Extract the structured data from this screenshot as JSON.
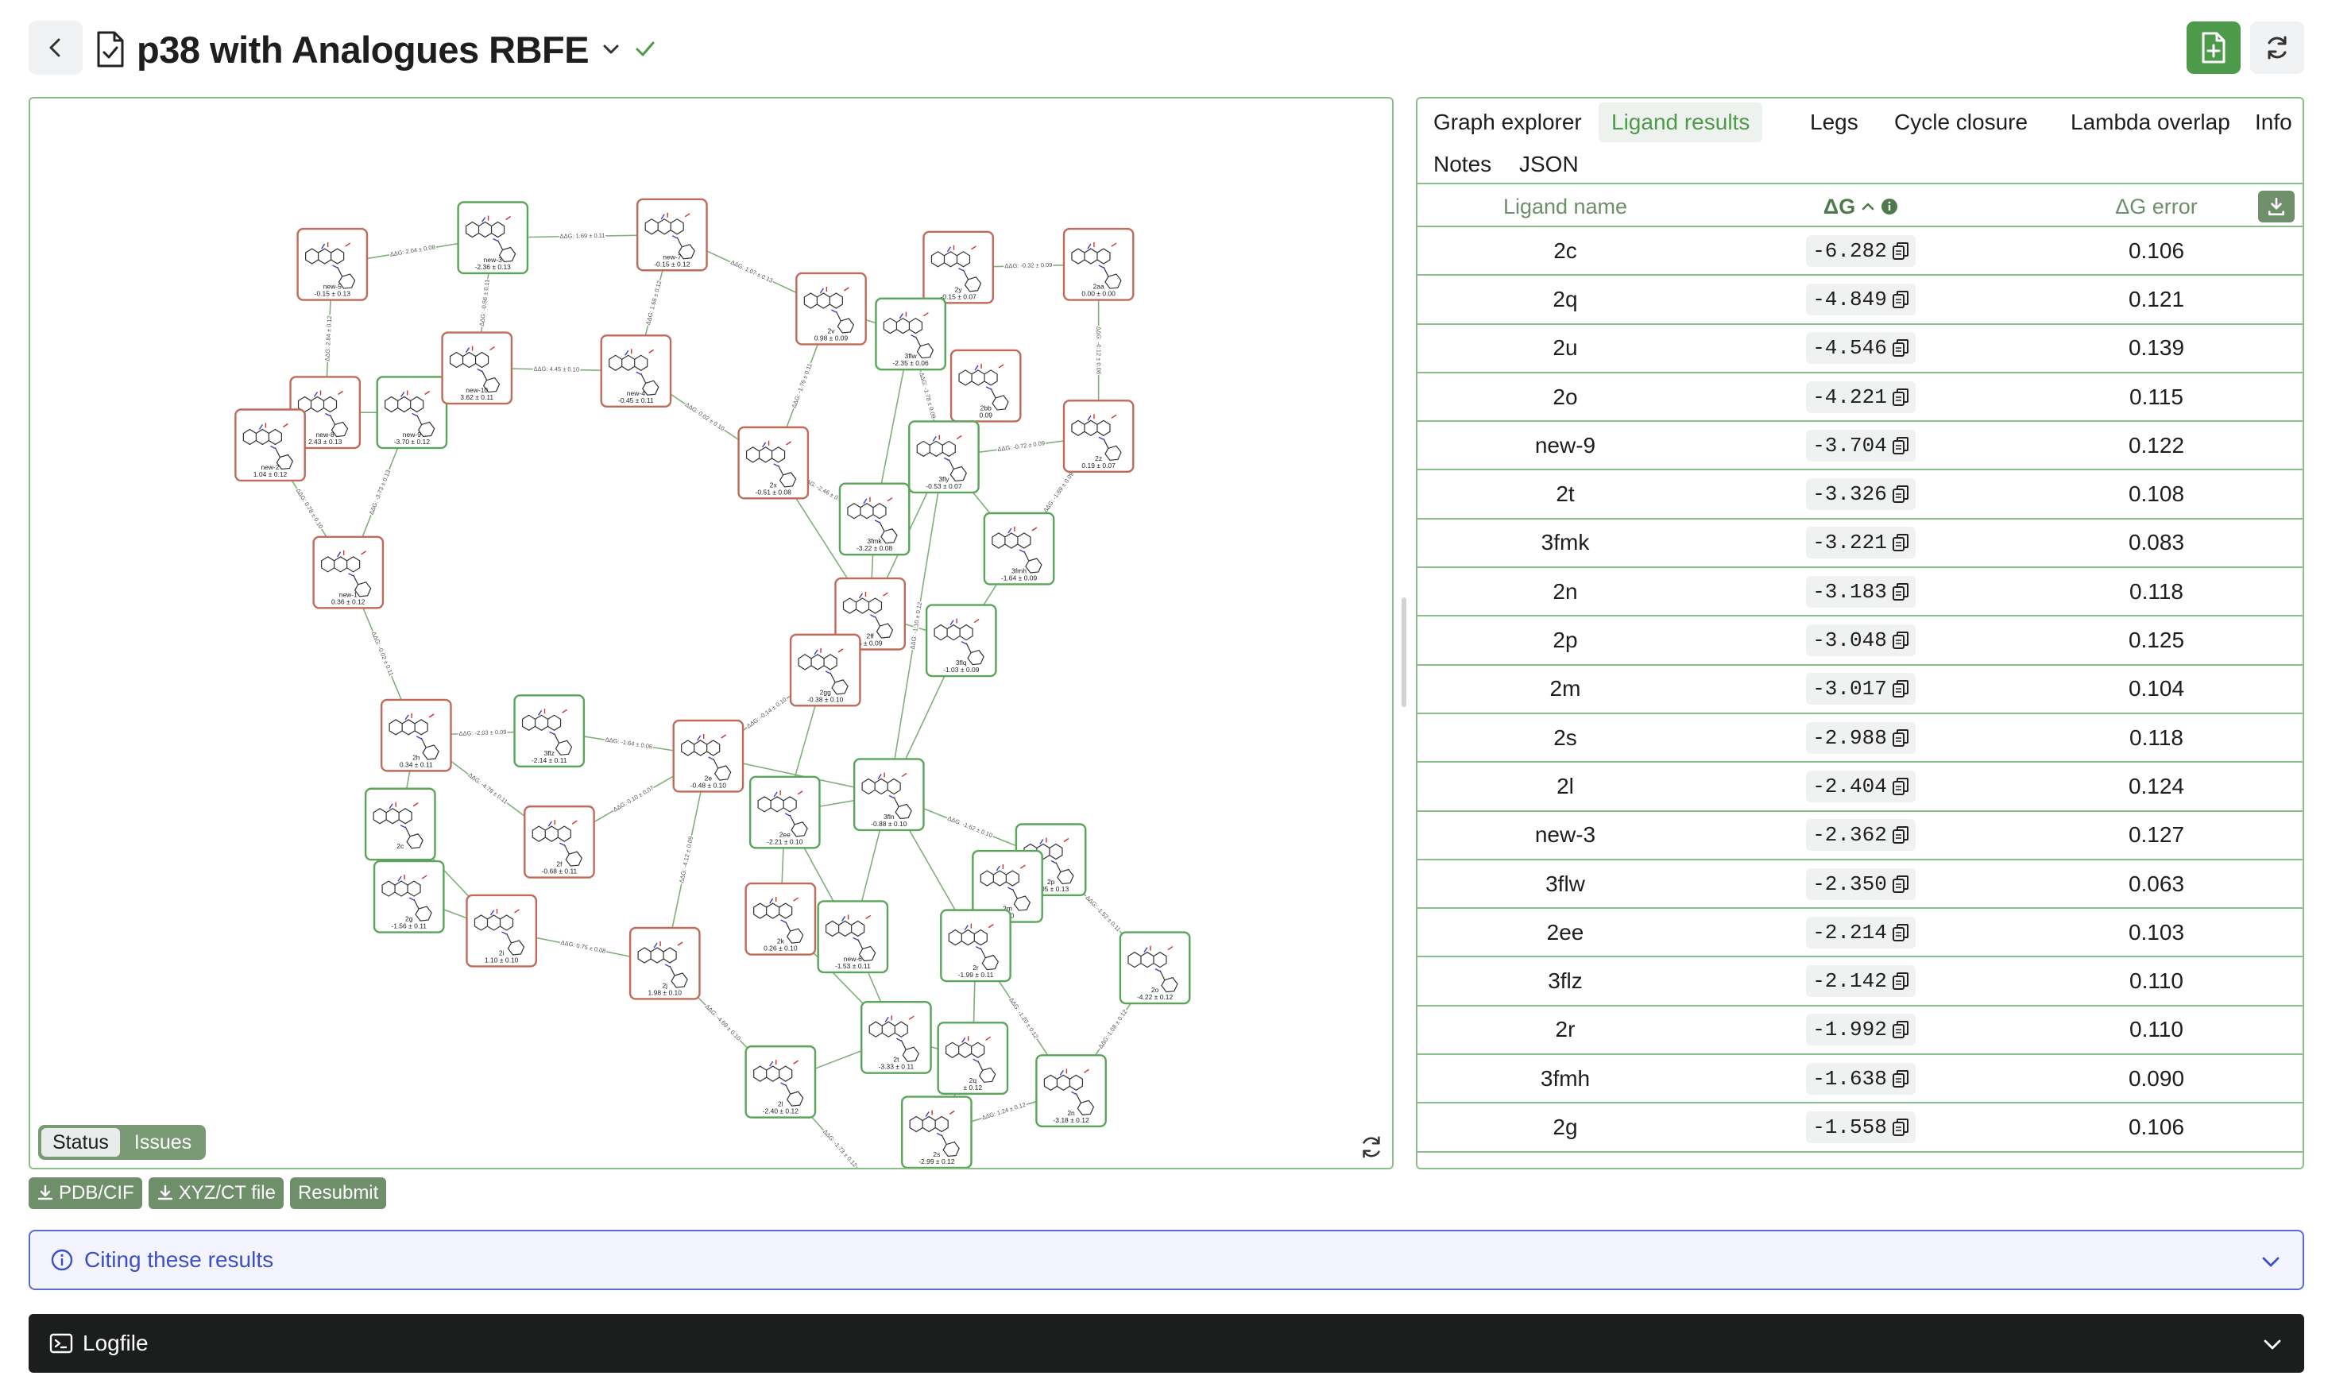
{
  "header": {
    "title": "p38 with Analogues RBFE",
    "status": "complete"
  },
  "graph": {
    "status_toggle": {
      "status_label": "Status",
      "issues_label": "Issues",
      "selected": "Status"
    },
    "colors": {
      "good": "#5aa55a",
      "bad": "#c06a5a",
      "edge": "#7fb07a",
      "node_bg": "#ffffff"
    },
    "nodes": [
      {
        "id": "new-5",
        "name": "new-5",
        "dg": "-0.15 ± 0.13",
        "status": "bad"
      },
      {
        "id": "new-3",
        "name": "new-3",
        "dg": "-2.36 ± 0.13",
        "status": "good"
      },
      {
        "id": "new-7",
        "name": "new-7",
        "dg": "-0.15 ± 0.12",
        "status": "bad"
      },
      {
        "id": "2v",
        "name": "2v",
        "dg": "0.98 ± 0.09",
        "status": "bad"
      },
      {
        "id": "2y",
        "name": "2y",
        "dg": "-0.15 ± 0.07",
        "status": "bad"
      },
      {
        "id": "3flw",
        "name": "3flw",
        "dg": "-2.35 ± 0.06",
        "status": "good"
      },
      {
        "id": "2aa",
        "name": "2aa",
        "dg": "0.00 ± 0.00",
        "status": "bad"
      },
      {
        "id": "2bb",
        "name": "2bb",
        "dg": "0.09",
        "status": "bad"
      },
      {
        "id": "new-8",
        "name": "new-8",
        "dg": "2.43 ± 0.13",
        "status": "bad"
      },
      {
        "id": "new-2",
        "name": "new-2",
        "dg": "1.04 ± 0.12",
        "status": "bad"
      },
      {
        "id": "new-9",
        "name": "new-9",
        "dg": "-3.70 ± 0.12",
        "status": "good"
      },
      {
        "id": "new-10",
        "name": "new-10",
        "dg": "3.62 ± 0.11",
        "status": "bad"
      },
      {
        "id": "new-4",
        "name": "new-4",
        "dg": "-0.45 ± 0.11",
        "status": "bad"
      },
      {
        "id": "2x",
        "name": "2x",
        "dg": "-0.51 ± 0.08",
        "status": "bad"
      },
      {
        "id": "3fly",
        "name": "3fly",
        "dg": "-0.53 ± 0.07",
        "status": "good"
      },
      {
        "id": "2z",
        "name": "2z",
        "dg": "0.19 ± 0.07",
        "status": "bad"
      },
      {
        "id": "3fmk",
        "name": "3fmk",
        "dg": "-3.22 ± 0.08",
        "status": "good"
      },
      {
        "id": "3fmh",
        "name": "3fmh",
        "dg": "-1.64 ± 0.09",
        "status": "good"
      },
      {
        "id": "new-1",
        "name": "new-1",
        "dg": "0.36 ± 0.12",
        "status": "bad"
      },
      {
        "id": "2ff",
        "name": "2ff",
        "dg": "5 ± 0.09",
        "status": "bad"
      },
      {
        "id": "3fln",
        "name": "3flq",
        "dg": "-1.03 ± 0.09",
        "status": "good"
      },
      {
        "id": "2gg",
        "name": "2gg",
        "dg": "-0.38 ± 0.10",
        "status": "bad"
      },
      {
        "id": "2h",
        "name": "2h",
        "dg": "0.34 ± 0.11",
        "status": "bad"
      },
      {
        "id": "3flz",
        "name": "3flz",
        "dg": "-2.14 ± 0.11",
        "status": "good"
      },
      {
        "id": "2e",
        "name": "2e",
        "dg": "-0.48 ± 0.10",
        "status": "bad"
      },
      {
        "id": "2ee",
        "name": "2ee",
        "dg": "-2.21 ± 0.10",
        "status": "good"
      },
      {
        "id": "3fln2",
        "name": "3fln",
        "dg": "-0.88 ± 0.10",
        "status": "good"
      },
      {
        "id": "2c-a",
        "name": "2c",
        "dg": "",
        "status": "good"
      },
      {
        "id": "2f",
        "name": "2f",
        "dg": "-0.68 ± 0.11",
        "status": "bad"
      },
      {
        "id": "2p",
        "name": "2p",
        "dg": "-3.05 ± 0.13",
        "status": "good"
      },
      {
        "id": "2m",
        "name": "2m",
        "dg": "0.10",
        "status": "good"
      },
      {
        "id": "2g",
        "name": "2g",
        "dg": "-1.56 ± 0.11",
        "status": "good"
      },
      {
        "id": "2i",
        "name": "2i",
        "dg": "1.10 ± 0.10",
        "status": "bad"
      },
      {
        "id": "2j",
        "name": "2j",
        "dg": "1.98 ± 0.10",
        "status": "bad"
      },
      {
        "id": "2k",
        "name": "2k",
        "dg": "0.26 ± 0.10",
        "status": "bad"
      },
      {
        "id": "new-6",
        "name": "new-6",
        "dg": "-1.53 ± 0.11",
        "status": "good"
      },
      {
        "id": "2r",
        "name": "2r",
        "dg": "-1.99 ± 0.11",
        "status": "good"
      },
      {
        "id": "2o",
        "name": "2o",
        "dg": "-4.22 ± 0.12",
        "status": "good"
      },
      {
        "id": "2t",
        "name": "2t",
        "dg": "-3.33 ± 0.11",
        "status": "good"
      },
      {
        "id": "2q",
        "name": "2q",
        "dg": "± 0.12",
        "status": "good"
      },
      {
        "id": "2l",
        "name": "2l",
        "dg": "-2.40 ± 0.12",
        "status": "good"
      },
      {
        "id": "2n",
        "name": "2n",
        "dg": "-3.18 ± 0.12",
        "status": "good"
      },
      {
        "id": "2s",
        "name": "2s",
        "dg": "-2.99 ± 0.12",
        "status": "good"
      },
      {
        "id": "2u",
        "name": "2u",
        "dg": "-4.55 ± 0.14",
        "status": "good"
      }
    ],
    "edges": [
      {
        "from": "new-5",
        "to": "new-3",
        "label": "ΔΔG: 2.04 ± 0.08"
      },
      {
        "from": "new-3",
        "to": "new-7",
        "label": "ΔΔG: 1.69 ± 0.11"
      },
      {
        "from": "new-7",
        "to": "2v",
        "label": "ΔΔG: 1.07 ± 0.13"
      },
      {
        "from": "new-7",
        "to": "new-4",
        "label": "ΔΔG: 1.68 ± 0.12"
      },
      {
        "from": "2y",
        "to": "2aa",
        "label": "ΔΔG: -0.32 ± 0.09"
      },
      {
        "from": "2y",
        "to": "3flw",
        "label": ""
      },
      {
        "from": "2v",
        "to": "3flw",
        "label": ""
      },
      {
        "from": "2aa",
        "to": "2z",
        "label": "ΔΔG: -0.12 ± 0.08"
      },
      {
        "from": "new-5",
        "to": "new-8",
        "label": "ΔΔG: 2.84 ± 0.12"
      },
      {
        "from": "new-3",
        "to": "new-10",
        "label": "ΔΔG: -0.56 ± 0.11"
      },
      {
        "from": "new-8",
        "to": "new-9",
        "label": ""
      },
      {
        "from": "new-9",
        "to": "new-10",
        "label": ""
      },
      {
        "from": "new-10",
        "to": "new-4",
        "label": "ΔΔG: 4.45 ± 0.10"
      },
      {
        "from": "new-8",
        "to": "new-2",
        "label": ""
      },
      {
        "from": "new-4",
        "to": "2x",
        "label": "ΔΔG: 0.02 ± 0.10"
      },
      {
        "from": "2v",
        "to": "2x",
        "label": "ΔΔG: -1.76 ± 0.11"
      },
      {
        "from": "3flw",
        "to": "3fly",
        "label": "ΔΔG: -1.78 ± 0.09"
      },
      {
        "from": "2bb",
        "to": "3fly",
        "label": ""
      },
      {
        "from": "3fly",
        "to": "2z",
        "label": "ΔΔG: -0.72 ± 0.09"
      },
      {
        "from": "2x",
        "to": "3fmk",
        "label": "ΔΔG: -2.46 ± 0.10"
      },
      {
        "from": "3fly",
        "to": "3fmh",
        "label": ""
      },
      {
        "from": "2z",
        "to": "3fmh",
        "label": "ΔΔG: -1.69 ± 0.09"
      },
      {
        "from": "3flw",
        "to": "3fmk",
        "label": ""
      },
      {
        "from": "new-2",
        "to": "new-1",
        "label": "ΔΔG: 0.78 ± 0.10"
      },
      {
        "from": "new-9",
        "to": "new-1",
        "label": "ΔΔG: -3.73 ± 0.13"
      },
      {
        "from": "3fmk",
        "to": "2ff",
        "label": ""
      },
      {
        "from": "3fly",
        "to": "2ff",
        "label": ""
      },
      {
        "from": "3fmh",
        "to": "3fln",
        "label": ""
      },
      {
        "from": "2ff",
        "to": "3fln",
        "label": ""
      },
      {
        "from": "2x",
        "to": "2ff",
        "label": ""
      },
      {
        "from": "2ff",
        "to": "2gg",
        "label": ""
      },
      {
        "from": "3fly",
        "to": "3fln2",
        "label": "ΔΔG: -1.10 ± 0.12"
      },
      {
        "from": "new-1",
        "to": "2h",
        "label": "ΔΔG: -0.02 ± 0.11"
      },
      {
        "from": "2h",
        "to": "3flz",
        "label": "ΔΔG: -2.03 ± 0.09"
      },
      {
        "from": "3flz",
        "to": "2e",
        "label": "ΔΔG: -1.64 ± 0.06"
      },
      {
        "from": "2gg",
        "to": "2e",
        "label": "ΔΔG: -0.14 ± 0.10"
      },
      {
        "from": "2gg",
        "to": "2ee",
        "label": ""
      },
      {
        "from": "2e",
        "to": "3fln2",
        "label": ""
      },
      {
        "from": "2ee",
        "to": "3fln2",
        "label": ""
      },
      {
        "from": "3fln",
        "to": "3fln2",
        "label": ""
      },
      {
        "from": "3fln2",
        "to": "2p",
        "label": "ΔΔG: -1.62 ± 0.10"
      },
      {
        "from": "2h",
        "to": "2c-a",
        "label": ""
      },
      {
        "from": "2h",
        "to": "2f",
        "label": "ΔΔG: -4.79 ± 0.11"
      },
      {
        "from": "2c-a",
        "to": "2g",
        "label": ""
      },
      {
        "from": "2c-a",
        "to": "2i",
        "label": ""
      },
      {
        "from": "2e",
        "to": "2f",
        "label": "ΔΔG: 0.10 ± 0.07"
      },
      {
        "from": "2g",
        "to": "2i",
        "label": ""
      },
      {
        "from": "2i",
        "to": "2j",
        "label": "ΔΔG: 0.75 ± 0.08"
      },
      {
        "from": "2e",
        "to": "2j",
        "label": "ΔΔG: -4.12 ± 0.09"
      },
      {
        "from": "2ee",
        "to": "2k",
        "label": ""
      },
      {
        "from": "2ee",
        "to": "new-6",
        "label": ""
      },
      {
        "from": "3fln2",
        "to": "new-6",
        "label": ""
      },
      {
        "from": "3fln2",
        "to": "2r",
        "label": ""
      },
      {
        "from": "2p",
        "to": "2r",
        "label": ""
      },
      {
        "from": "2p",
        "to": "2o",
        "label": "ΔΔG: -1.52 ± 0.11"
      },
      {
        "from": "2j",
        "to": "2l",
        "label": "ΔΔG: -4.69 ± 0.10"
      },
      {
        "from": "2k",
        "to": "2t",
        "label": ""
      },
      {
        "from": "new-6",
        "to": "2t",
        "label": ""
      },
      {
        "from": "2r",
        "to": "2q",
        "label": ""
      },
      {
        "from": "2r",
        "to": "2n",
        "label": "ΔΔG: -1.20 ± 0.12"
      },
      {
        "from": "2o",
        "to": "2n",
        "label": "ΔΔG: 1.08 ± 0.12"
      },
      {
        "from": "2l",
        "to": "2t",
        "label": ""
      },
      {
        "from": "2t",
        "to": "2q",
        "label": ""
      },
      {
        "from": "2q",
        "to": "2s",
        "label": ""
      },
      {
        "from": "2n",
        "to": "2s",
        "label": "ΔΔG: 1.24 ± 0.12"
      },
      {
        "from": "2l",
        "to": "2u",
        "label": "ΔΔG: -1.73 ± 0.12"
      },
      {
        "from": "2s",
        "to": "2u",
        "label": ""
      }
    ]
  },
  "actions": {
    "pdb_label": "PDB/CIF",
    "xyz_label": "XYZ/CT file",
    "resubmit_label": "Resubmit"
  },
  "tabs": [
    {
      "label": "Graph explorer"
    },
    {
      "label": "Ligand results",
      "active": true
    },
    {
      "label": "Legs"
    },
    {
      "label": "Cycle closure"
    },
    {
      "label": "Lambda overlap"
    },
    {
      "label": "Info"
    },
    {
      "label": "Notes"
    },
    {
      "label": "JSON"
    }
  ],
  "table": {
    "columns": {
      "name": "Ligand name",
      "dg": "ΔG",
      "err": "ΔG error"
    },
    "sort": {
      "column": "dg",
      "direction": "ascending"
    },
    "rows": [
      {
        "name": "2c",
        "dg": "-6.282",
        "err": "0.106"
      },
      {
        "name": "2q",
        "dg": "-4.849",
        "err": "0.121"
      },
      {
        "name": "2u",
        "dg": "-4.546",
        "err": "0.139"
      },
      {
        "name": "2o",
        "dg": "-4.221",
        "err": "0.115"
      },
      {
        "name": "new-9",
        "dg": "-3.704",
        "err": "0.122"
      },
      {
        "name": "2t",
        "dg": "-3.326",
        "err": "0.108"
      },
      {
        "name": "3fmk",
        "dg": "-3.221",
        "err": "0.083"
      },
      {
        "name": "2n",
        "dg": "-3.183",
        "err": "0.118"
      },
      {
        "name": "2p",
        "dg": "-3.048",
        "err": "0.125"
      },
      {
        "name": "2m",
        "dg": "-3.017",
        "err": "0.104"
      },
      {
        "name": "2s",
        "dg": "-2.988",
        "err": "0.118"
      },
      {
        "name": "2l",
        "dg": "-2.404",
        "err": "0.124"
      },
      {
        "name": "new-3",
        "dg": "-2.362",
        "err": "0.127"
      },
      {
        "name": "3flw",
        "dg": "-2.350",
        "err": "0.063"
      },
      {
        "name": "2ee",
        "dg": "-2.214",
        "err": "0.103"
      },
      {
        "name": "3flz",
        "dg": "-2.142",
        "err": "0.110"
      },
      {
        "name": "2r",
        "dg": "-1.992",
        "err": "0.110"
      },
      {
        "name": "3fmh",
        "dg": "-1.638",
        "err": "0.090"
      },
      {
        "name": "2g",
        "dg": "-1.558",
        "err": "0.106"
      }
    ]
  },
  "cite": {
    "label": "Citing these results",
    "color": "#3b4fc8"
  },
  "logfile": {
    "label": "Logfile"
  }
}
